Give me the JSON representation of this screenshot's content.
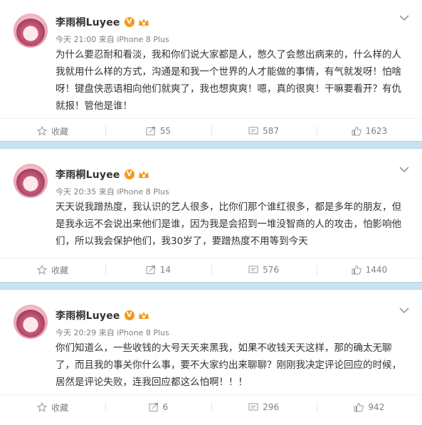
{
  "colors": {
    "divider": "#c7e3f0",
    "accent": "#f29b1b",
    "muted": "#808080"
  },
  "posts": [
    {
      "author": "李雨桐Luyee",
      "verified_badge": "V",
      "time": "今天 21:00",
      "source": "来自 iPhone 8 Plus",
      "text": "为什么要忍耐和看淡，我和你们说大家都是人，憋久了会憋出病来的，什么样的人我就用什么样的方式，沟通是和我一个世界的人才能做的事情，有气就发呀！怕啥呀！键盘侠恶语相向他们就爽了，我也想爽爽！嗯，真的很爽！干嘛要看开？有仇就报！管他是谁！",
      "actions": {
        "favorite": "收藏",
        "repost": "55",
        "comment": "587",
        "like": "1623"
      }
    },
    {
      "author": "李雨桐Luyee",
      "verified_badge": "V",
      "time": "今天 20:35",
      "source": "来自 iPhone 8 Plus",
      "text": "天天说我蹭热度，我认识的艺人很多，比你们那个谁红很多，都是多年的朋友，但是我永远不会说出来他们是谁，因为我是会招到一堆没智商的人的攻击，怕影响他们，所以我会保护他们，我30岁了，要蹭热度不用等到今天",
      "actions": {
        "favorite": "收藏",
        "repost": "14",
        "comment": "576",
        "like": "1440"
      }
    },
    {
      "author": "李雨桐Luyee",
      "verified_badge": "V",
      "time": "今天 20:29",
      "source": "来自 iPhone 8 Plus",
      "text": "你们知道么，一些收钱的大号天天来黑我，如果不收钱天天这样，那的确太无聊了，而且我的事关你什么事，要不大家约出来聊聊？刚刚我决定评论回应的时候，居然是评论失败，连我回应都这么怕啊！！！",
      "actions": {
        "favorite": "收藏",
        "repost": "6",
        "comment": "296",
        "like": "942"
      }
    }
  ]
}
